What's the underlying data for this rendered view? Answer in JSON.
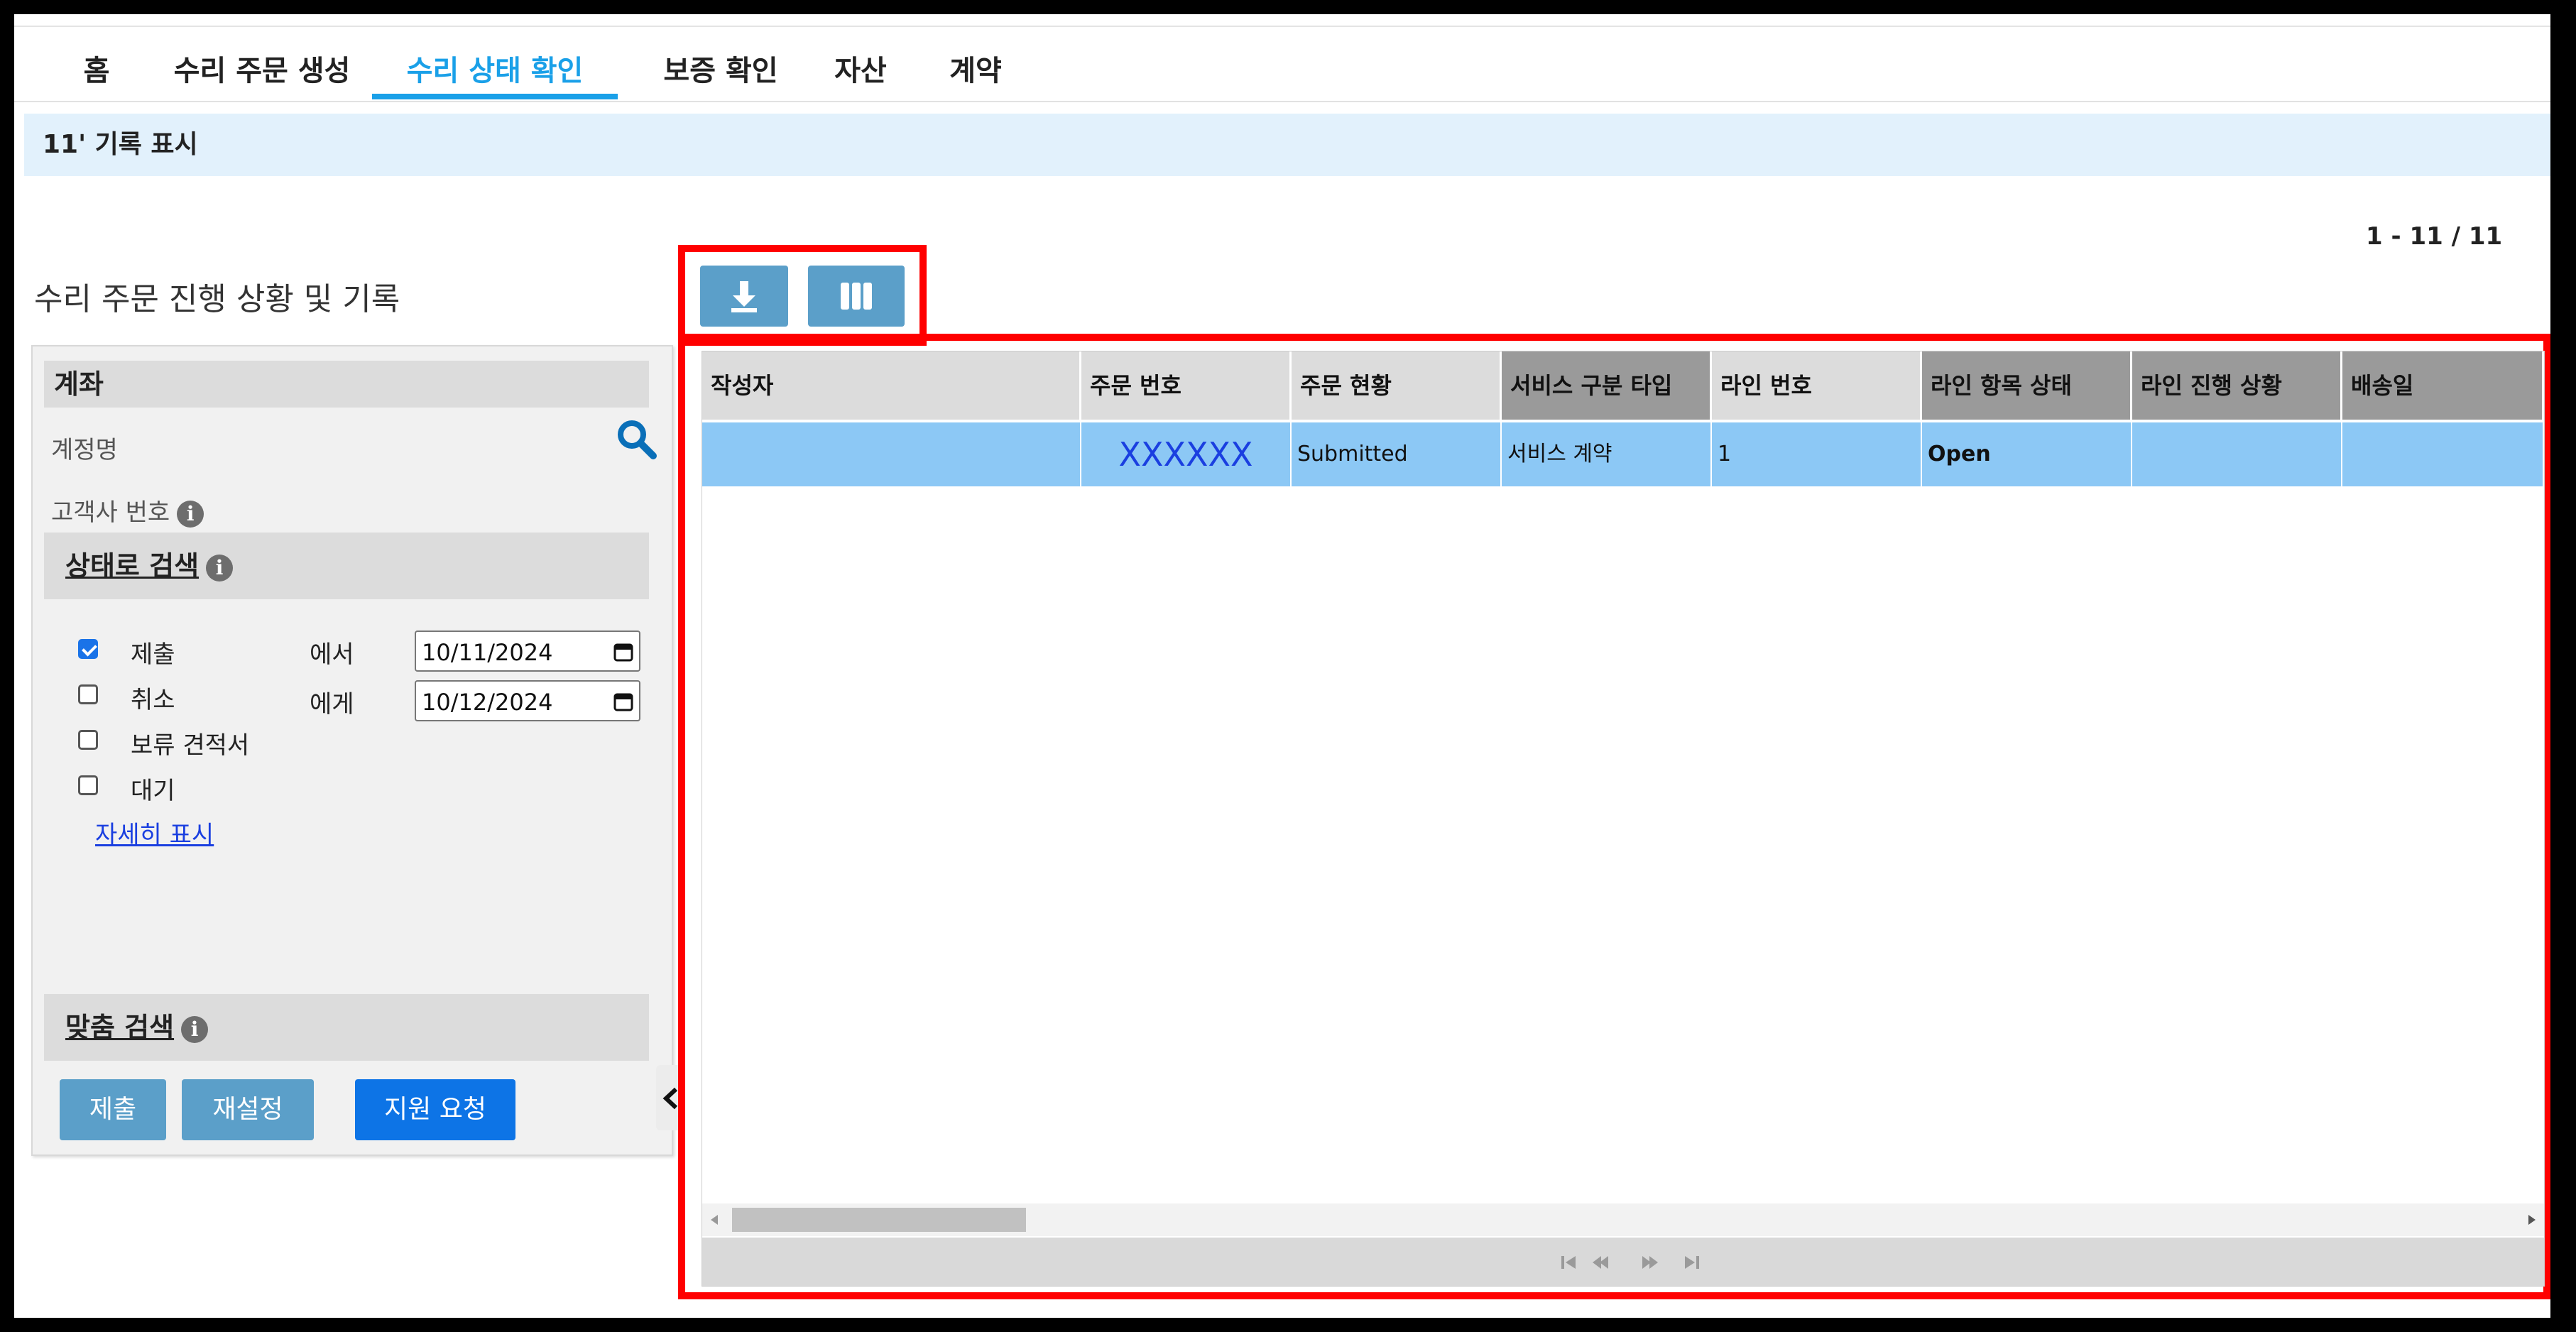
{
  "nav": {
    "tabs": [
      {
        "label": "홈"
      },
      {
        "label": "수리 주문 생성"
      },
      {
        "label": "수리 상태 확인"
      },
      {
        "label": "보증 확인"
      },
      {
        "label": "자산"
      },
      {
        "label": "계약"
      }
    ],
    "active_index": 2
  },
  "info_bar": {
    "text": "11' 기록 표시"
  },
  "pager": {
    "text": "1 - 11 / 11"
  },
  "page_title": "수리 주문 진행 상황 및 기록",
  "filter_panel": {
    "account": {
      "heading": "계좌",
      "account_name_label": "계정명",
      "customer_number_label": "고객사 번호"
    },
    "status_search": {
      "heading": "상태로 검색",
      "options": [
        {
          "label": "제출",
          "checked": true
        },
        {
          "label": "취소",
          "checked": false
        },
        {
          "label": "보류 견적서",
          "checked": false
        },
        {
          "label": "대기",
          "checked": false
        }
      ],
      "from_label": "에서",
      "from_value": "10/11/2024",
      "to_label": "에게",
      "to_value": "10/12/2024",
      "more_link": "자세히 표시"
    },
    "custom_search": {
      "heading": "맞춤 검색"
    },
    "buttons": {
      "submit": "제출",
      "reset": "재설정",
      "support": "지원 요청"
    }
  },
  "grid": {
    "columns": [
      "작성자",
      "주문 번호",
      "주문 현황",
      "서비스 구분 타입",
      "라인 번호",
      "라인 항목 상태",
      "라인 진행 상황",
      "배송일"
    ],
    "rows": [
      [
        "",
        "XXXXXX",
        "Submitted",
        "서비스 계약",
        "1",
        "Open",
        "",
        ""
      ]
    ]
  },
  "colors": {
    "accent": "#1aa0e8",
    "highlight_box": "#ff0000",
    "selected_row": "#8cc8f5",
    "button": "#5b9fc9",
    "primary_button": "#0d74e6"
  },
  "icons": {
    "search": "search-icon",
    "download": "download-icon",
    "columns": "columns-icon",
    "info": "info-icon",
    "collapse": "chevron-left-icon"
  }
}
